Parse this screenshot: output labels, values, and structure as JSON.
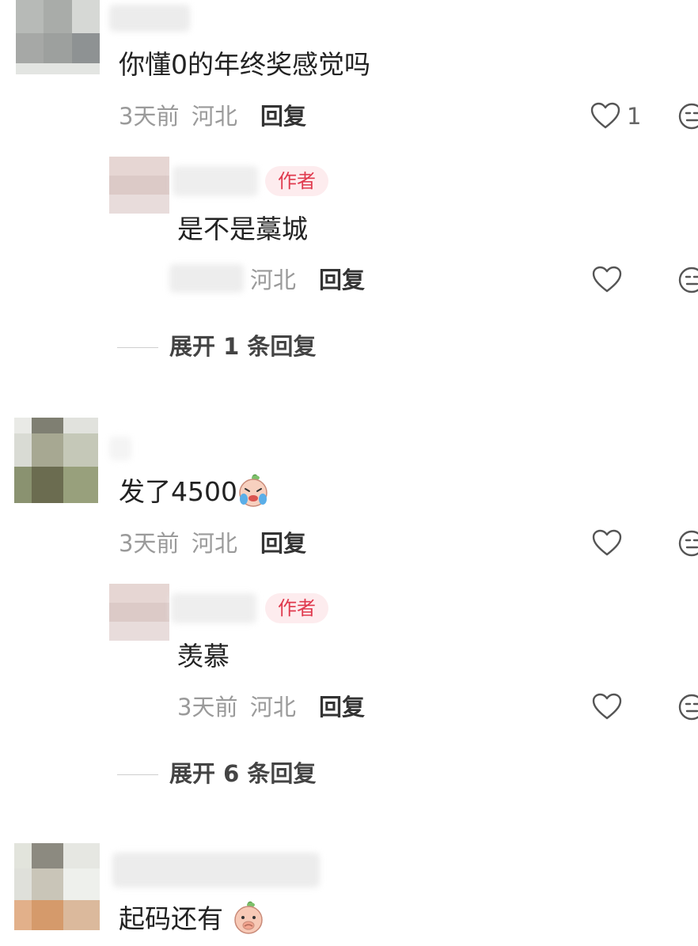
{
  "comments": [
    {
      "text": "你懂0的年终奖感觉吗",
      "time": "3天前",
      "location": "河北",
      "reply_label": "回复",
      "like_count": "1",
      "author_reply": {
        "badge": "作者",
        "text": "是不是藁城",
        "location": "河北",
        "reply_label": "回复"
      },
      "expand_label": "展开 1 条回复"
    },
    {
      "text": "发了4500",
      "emoji": "crying-peach-emoji",
      "time": "3天前",
      "location": "河北",
      "reply_label": "回复",
      "author_reply": {
        "badge": "作者",
        "text": "羡慕",
        "time": "3天前",
        "location": "河北",
        "reply_label": "回复"
      },
      "expand_label": "展开 6 条回复"
    },
    {
      "text": "起码还有",
      "emoji": "peach-emoji"
    }
  ],
  "colors": {
    "badge_bg": "#fdecee",
    "badge_text": "#e03a4e",
    "meta_text": "#9a9a9a"
  }
}
